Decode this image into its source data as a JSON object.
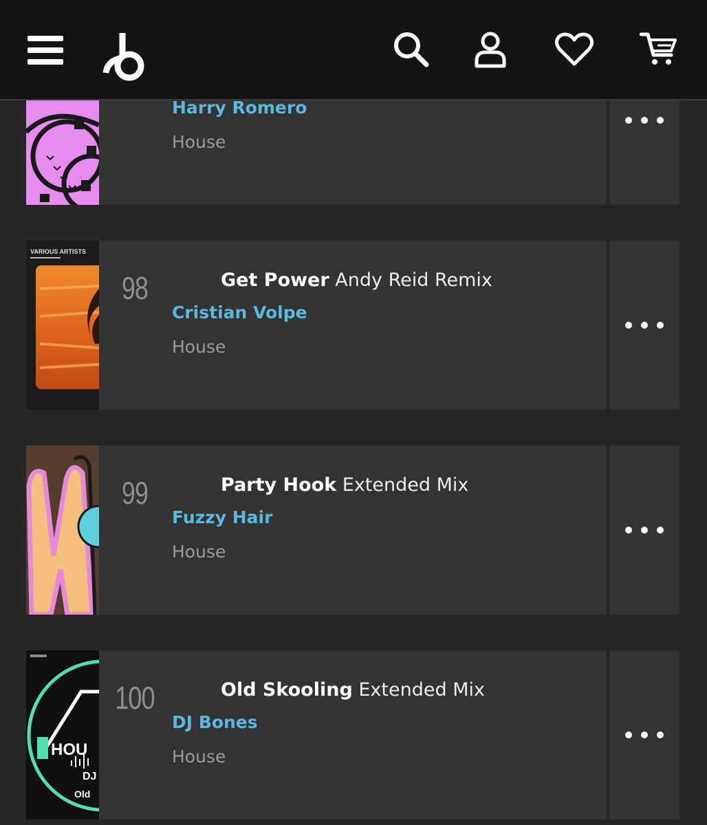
{
  "header": {
    "icons": [
      "menu-icon",
      "beatport-logo",
      "search-icon",
      "account-icon",
      "heart-icon",
      "cart-icon"
    ]
  },
  "colors": {
    "header_bg": "#141414",
    "page_bg": "#262626",
    "card_bg": "#333333",
    "artist": "#59b8dc",
    "genre": "#9a9a9a",
    "rank": "#8e8e8e"
  },
  "tracks": [
    {
      "rank": "",
      "title": "",
      "mix": "",
      "artist": "Harry Romero",
      "genre": "House",
      "artwork_icon": "pink-film-reel-artwork"
    },
    {
      "rank": "98",
      "title": "Get Power",
      "mix": "Andy Reid Remix",
      "artist": "Cristian Volpe",
      "genre": "House",
      "artwork_icon": "various-artists-festival-artwork",
      "artwork_text": "VARIOUS ARTISTS"
    },
    {
      "rank": "99",
      "title": "Party Hook",
      "mix": "Extended Mix",
      "artist": "Fuzzy Hair",
      "genre": "House",
      "artwork_icon": "pink-letter-artwork"
    },
    {
      "rank": "100",
      "title": "Old Skooling",
      "mix": "Extended Mix",
      "artist": "DJ Bones",
      "genre": "House",
      "artwork_icon": "house-record-artwork",
      "artwork_text_1": "HOU",
      "artwork_text_2": "DJ",
      "artwork_text_3": "Old"
    }
  ]
}
